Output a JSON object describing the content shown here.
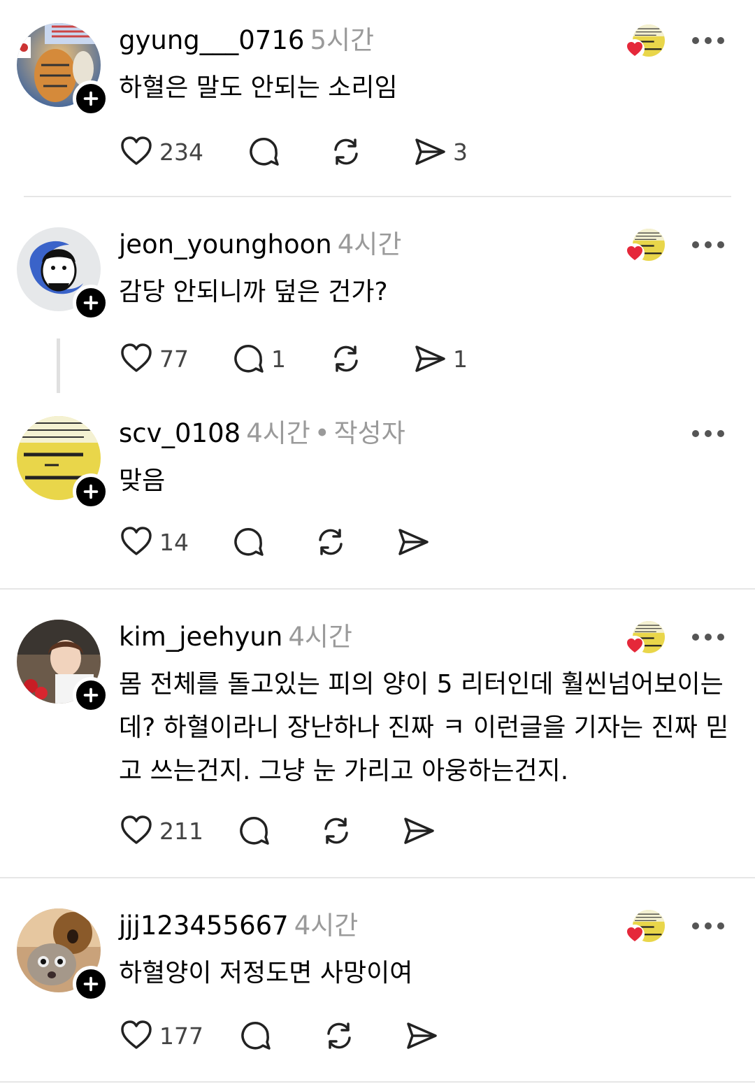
{
  "posts": [
    {
      "username": "gyung___0716",
      "time": "5시간",
      "text": "하혈은 말도 안되는 소리임",
      "likes": "234",
      "replies": "",
      "shares": "3",
      "author_label": ""
    },
    {
      "username": "jeon_younghoon",
      "time": "4시간",
      "text": "감당 안되니까 덮은 건가?",
      "likes": "77",
      "replies": "1",
      "shares": "1",
      "author_label": ""
    },
    {
      "username": "scv_0108",
      "time": "4시간",
      "text": "맞음",
      "likes": "14",
      "replies": "",
      "shares": "",
      "author_label": "작성자",
      "sep": "•"
    },
    {
      "username": "kim_jeehyun",
      "time": "4시간",
      "text": "몸 전체를 돌고있는 피의 양이 5 리터인데 훨씬넘어보이는데? 하혈이라니 장난하나 진짜 ㅋ 이런글을 기자는 진짜 믿고 쓰는건지. 그냥 눈 가리고 아웅하는건지.",
      "likes": "211",
      "replies": "",
      "shares": "",
      "author_label": ""
    },
    {
      "username": "jjj123455667",
      "time": "4시간",
      "text": "하혈양이 저정도면 사망이여",
      "likes": "177",
      "replies": "",
      "shares": "",
      "author_label": ""
    }
  ],
  "colors": {
    "heart_badge": "#e5283a",
    "badge": "#000000",
    "muted": "#9a9a9a",
    "divider": "#e6e6e6"
  },
  "icons": [
    "heart-icon",
    "comment-icon",
    "repost-icon",
    "share-icon",
    "more-icon",
    "plus-icon"
  ]
}
